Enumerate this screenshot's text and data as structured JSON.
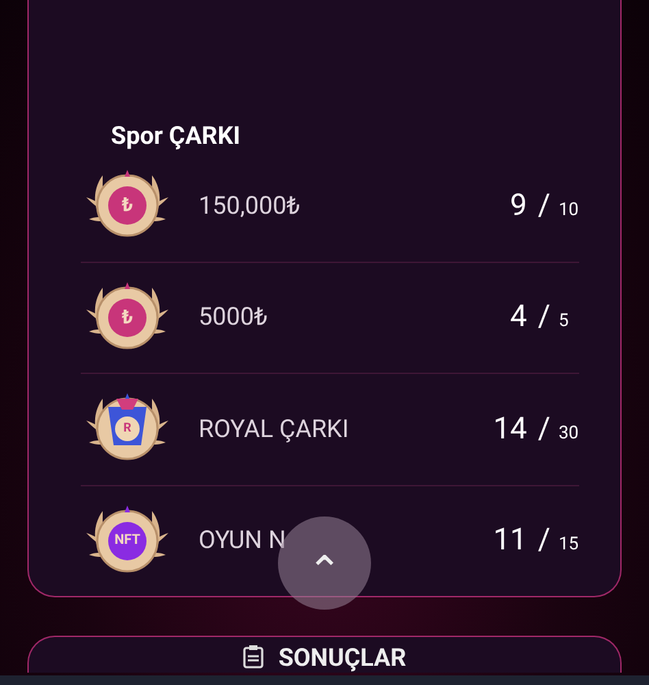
{
  "card": {
    "title": "Spor ÇARKI",
    "rows": [
      {
        "kind": "lira",
        "symbol": "₺",
        "name": "150,000₺",
        "count": "9",
        "separator": "/",
        "total": "10"
      },
      {
        "kind": "lira",
        "symbol": "₺",
        "name": "5000₺",
        "count": "4",
        "separator": "/",
        "total": "5"
      },
      {
        "kind": "royal",
        "symbol": "R",
        "name": "ROYAL ÇARKI",
        "count": "14",
        "separator": "/",
        "total": "30"
      },
      {
        "kind": "nft",
        "symbol": "NFT",
        "name": "OYUN N",
        "count": "11",
        "separator": "/",
        "total": "15"
      }
    ]
  },
  "scroll_top_button": {
    "icon": "⌃"
  },
  "results_button": {
    "label": "SONUÇLAR"
  }
}
